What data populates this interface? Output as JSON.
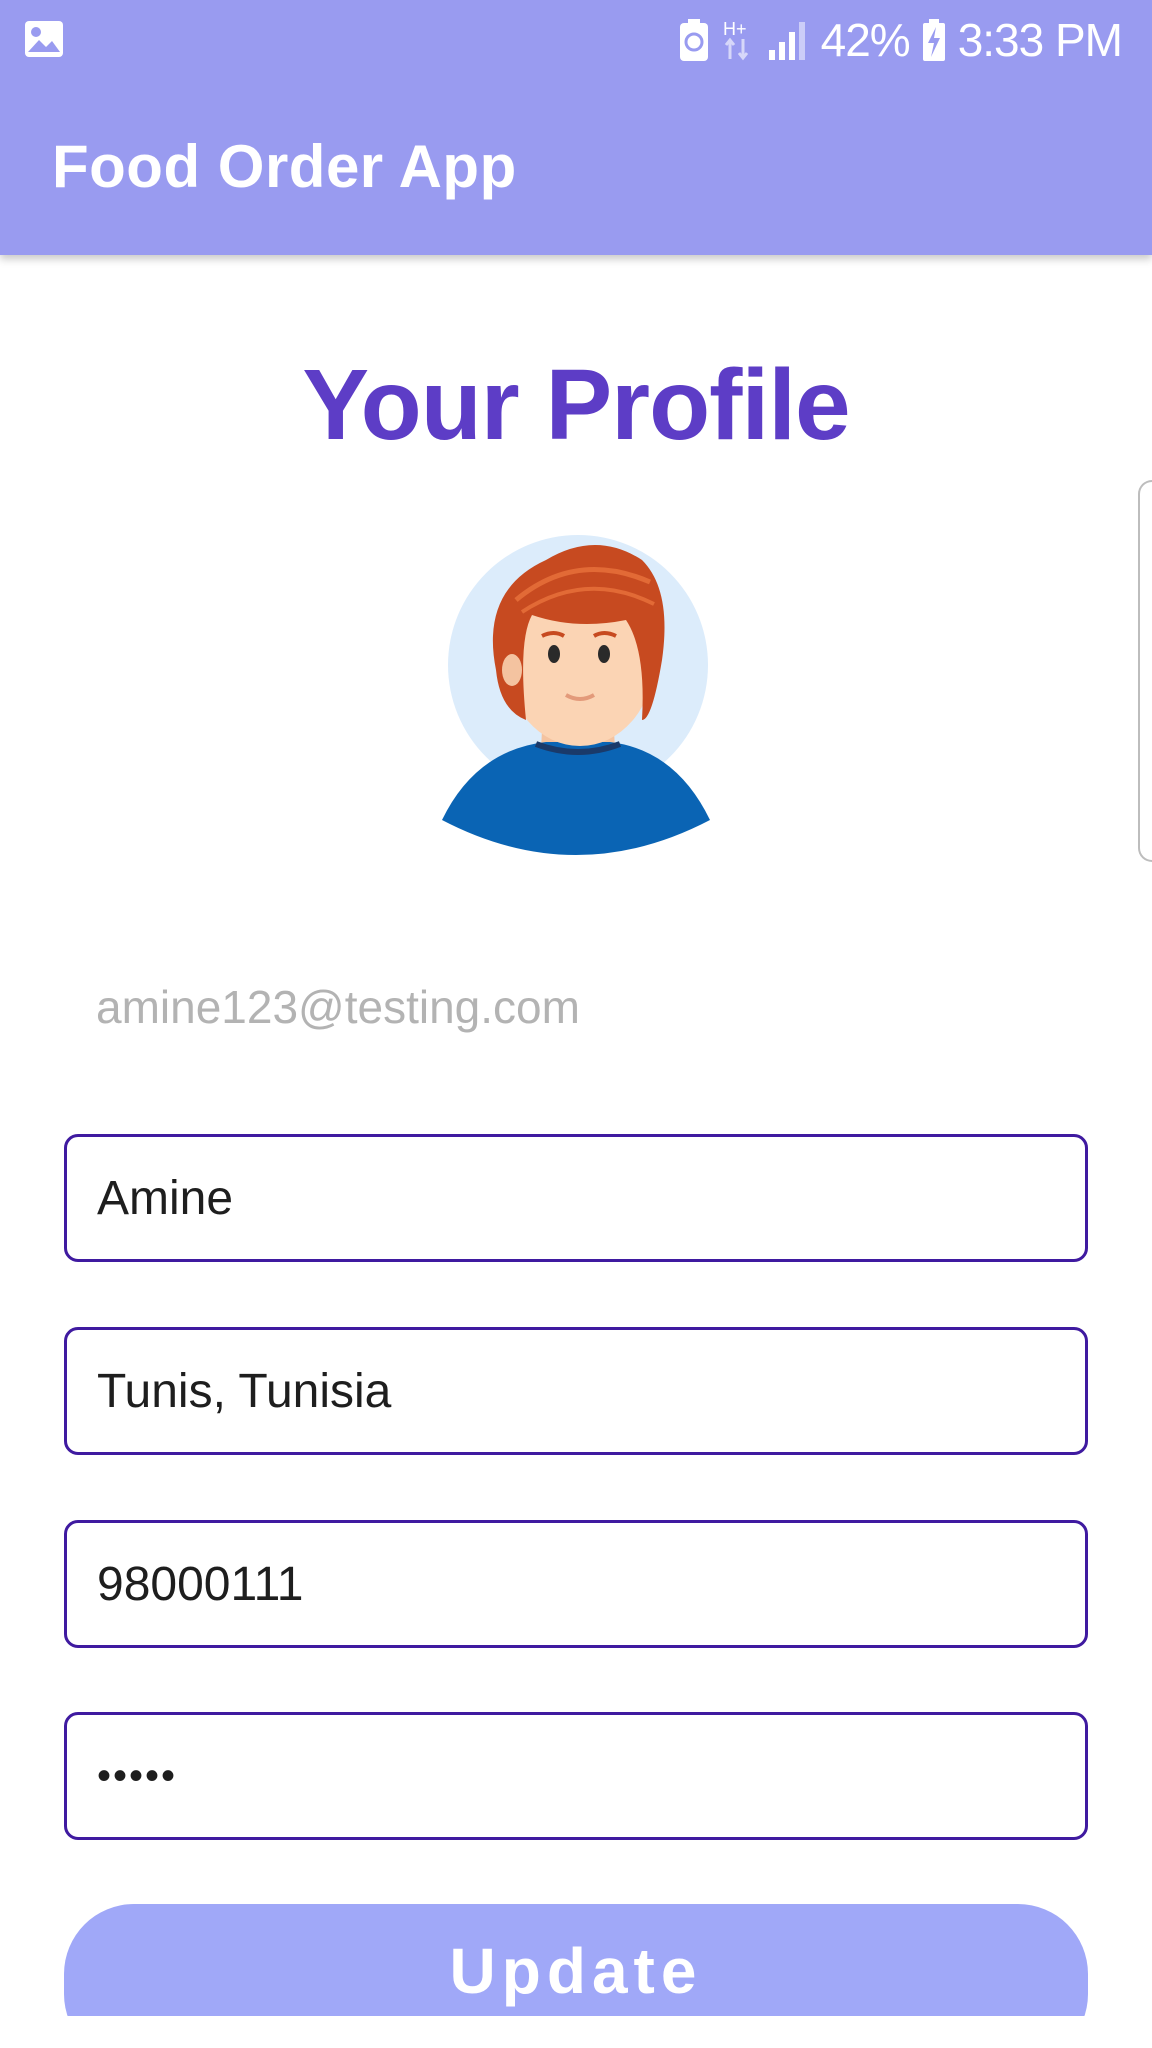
{
  "status_bar": {
    "left_icon": "image-icon",
    "icons": [
      "recycle-battery-icon",
      "hplus-network-icon",
      "signal-icon",
      "battery-charging-icon"
    ],
    "network_label": "H+",
    "battery_percent": "42%",
    "time": "3:33 PM"
  },
  "app_bar": {
    "title": "Food Order App"
  },
  "profile": {
    "title": "Your Profile",
    "avatar": "avatar-illustration",
    "email": "amine123@testing.com"
  },
  "form": {
    "name": "Amine",
    "address": "Tunis, Tunisia",
    "phone": "98000111",
    "password_masked": "•••••",
    "update_label": "Update"
  },
  "colors": {
    "app_bar": "#999bf0",
    "title": "#5d3dc6",
    "field_border": "#3f1aa0",
    "button": "#a0a8f8"
  }
}
